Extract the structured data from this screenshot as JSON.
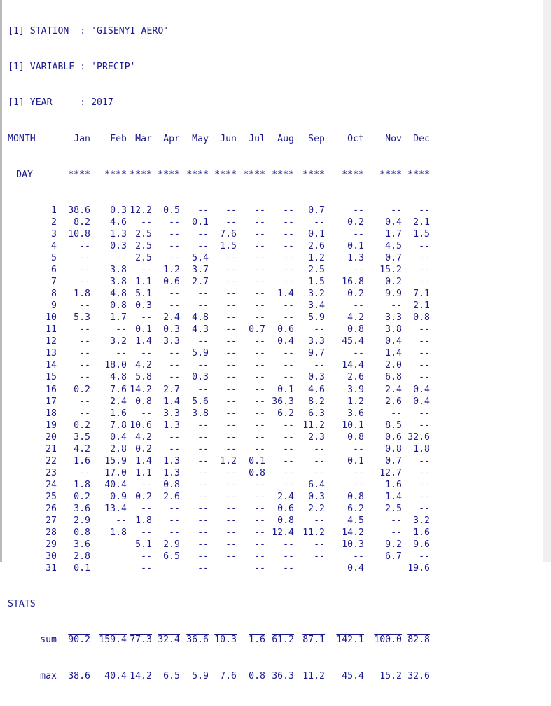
{
  "header": {
    "station_line": "[1] STATION  : 'GISENYI AERO'",
    "variable_line": "[1] VARIABLE : 'PRECIP'",
    "year_line": "[1] YEAR     : 2017"
  },
  "columns": {
    "month_label": "MONTH",
    "day_label": "DAY",
    "months": [
      "Jan",
      "Feb",
      "Mar",
      "Apr",
      "May",
      "Jun",
      "Jul",
      "Aug",
      "Sep",
      "Oct",
      "Nov",
      "Dec"
    ],
    "stars": "****"
  },
  "rows": [
    {
      "day": "1",
      "v": [
        "38.6",
        "0.3",
        "12.2",
        "0.5",
        "--",
        "--",
        "--",
        "--",
        "0.7",
        "--",
        "--",
        "--"
      ]
    },
    {
      "day": "2",
      "v": [
        "8.2",
        "4.6",
        "--",
        "--",
        "0.1",
        "--",
        "--",
        "--",
        "--",
        "0.2",
        "0.4",
        "2.1"
      ]
    },
    {
      "day": "3",
      "v": [
        "10.8",
        "1.3",
        "2.5",
        "--",
        "--",
        "7.6",
        "--",
        "--",
        "0.1",
        "--",
        "1.7",
        "1.5"
      ]
    },
    {
      "day": "4",
      "v": [
        "--",
        "0.3",
        "2.5",
        "--",
        "--",
        "1.5",
        "--",
        "--",
        "2.6",
        "0.1",
        "4.5",
        "--"
      ]
    },
    {
      "day": "5",
      "v": [
        "--",
        "--",
        "2.5",
        "--",
        "5.4",
        "--",
        "--",
        "--",
        "1.2",
        "1.3",
        "0.7",
        "--"
      ]
    },
    {
      "day": "6",
      "v": [
        "--",
        "3.8",
        "--",
        "1.2",
        "3.7",
        "--",
        "--",
        "--",
        "2.5",
        "--",
        "15.2",
        "--"
      ]
    },
    {
      "day": "7",
      "v": [
        "--",
        "3.8",
        "1.1",
        "0.6",
        "2.7",
        "--",
        "--",
        "--",
        "1.5",
        "16.8",
        "0.2",
        "--"
      ]
    },
    {
      "day": "8",
      "v": [
        "1.8",
        "4.8",
        "5.1",
        "--",
        "--",
        "--",
        "--",
        "1.4",
        "3.2",
        "0.2",
        "9.9",
        "7.1"
      ]
    },
    {
      "day": "9",
      "v": [
        "--",
        "0.8",
        "0.3",
        "--",
        "--",
        "--",
        "--",
        "--",
        "3.4",
        "--",
        "--",
        "2.1"
      ]
    },
    {
      "day": "10",
      "v": [
        "5.3",
        "1.7",
        "--",
        "2.4",
        "4.8",
        "--",
        "--",
        "--",
        "5.9",
        "4.2",
        "3.3",
        "0.8"
      ]
    },
    {
      "day": "11",
      "v": [
        "--",
        "--",
        "0.1",
        "0.3",
        "4.3",
        "--",
        "0.7",
        "0.6",
        "--",
        "0.8",
        "3.8",
        "--"
      ]
    },
    {
      "day": "12",
      "v": [
        "--",
        "3.2",
        "1.4",
        "3.3",
        "--",
        "--",
        "--",
        "0.4",
        "3.3",
        "45.4",
        "0.4",
        "--"
      ]
    },
    {
      "day": "13",
      "v": [
        "--",
        "--",
        "--",
        "--",
        "5.9",
        "--",
        "--",
        "--",
        "9.7",
        "--",
        "1.4",
        "--"
      ]
    },
    {
      "day": "14",
      "v": [
        "--",
        "18.0",
        "4.2",
        "--",
        "--",
        "--",
        "--",
        "--",
        "--",
        "14.4",
        "2.0",
        "--"
      ]
    },
    {
      "day": "15",
      "v": [
        "--",
        "4.8",
        "5.8",
        "--",
        "0.3",
        "--",
        "--",
        "--",
        "0.3",
        "2.6",
        "6.8",
        "--"
      ]
    },
    {
      "day": "16",
      "v": [
        "0.2",
        "7.6",
        "14.2",
        "2.7",
        "--",
        "--",
        "--",
        "0.1",
        "4.6",
        "3.9",
        "2.4",
        "0.4"
      ]
    },
    {
      "day": "17",
      "v": [
        "--",
        "2.4",
        "0.8",
        "1.4",
        "5.6",
        "--",
        "--",
        "36.3",
        "8.2",
        "1.2",
        "2.6",
        "0.4"
      ]
    },
    {
      "day": "18",
      "v": [
        "--",
        "1.6",
        "--",
        "3.3",
        "3.8",
        "--",
        "--",
        "6.2",
        "6.3",
        "3.6",
        "--",
        "--"
      ]
    },
    {
      "day": "19",
      "v": [
        "0.2",
        "7.8",
        "10.6",
        "1.3",
        "--",
        "--",
        "--",
        "--",
        "11.2",
        "10.1",
        "8.5",
        "--"
      ]
    },
    {
      "day": "20",
      "v": [
        "3.5",
        "0.4",
        "4.2",
        "--",
        "--",
        "--",
        "--",
        "--",
        "2.3",
        "0.8",
        "0.6",
        "32.6"
      ]
    },
    {
      "day": "21",
      "v": [
        "4.2",
        "2.8",
        "0.2",
        "--",
        "--",
        "--",
        "--",
        "--",
        "--",
        "--",
        "0.8",
        "1.8"
      ]
    },
    {
      "day": "22",
      "v": [
        "1.6",
        "15.9",
        "1.4",
        "1.3",
        "--",
        "1.2",
        "0.1",
        "--",
        "--",
        "0.1",
        "0.7",
        "--"
      ]
    },
    {
      "day": "23",
      "v": [
        "--",
        "17.0",
        "1.1",
        "1.3",
        "--",
        "--",
        "0.8",
        "--",
        "--",
        "--",
        "12.7",
        "--"
      ]
    },
    {
      "day": "24",
      "v": [
        "1.8",
        "40.4",
        "--",
        "0.8",
        "--",
        "--",
        "--",
        "--",
        "6.4",
        "--",
        "1.6",
        "--"
      ]
    },
    {
      "day": "25",
      "v": [
        "0.2",
        "0.9",
        "0.2",
        "2.6",
        "--",
        "--",
        "--",
        "2.4",
        "0.3",
        "0.8",
        "1.4",
        "--"
      ]
    },
    {
      "day": "26",
      "v": [
        "3.6",
        "13.4",
        "--",
        "--",
        "--",
        "--",
        "--",
        "0.6",
        "2.2",
        "6.2",
        "2.5",
        "--"
      ]
    },
    {
      "day": "27",
      "v": [
        "2.9",
        "--",
        "1.8",
        "--",
        "--",
        "--",
        "--",
        "0.8",
        "--",
        "4.5",
        "--",
        "3.2"
      ]
    },
    {
      "day": "28",
      "v": [
        "0.8",
        "1.8",
        "--",
        "--",
        "--",
        "--",
        "--",
        "12.4",
        "11.2",
        "14.2",
        "--",
        "1.6"
      ]
    },
    {
      "day": "29",
      "v": [
        "3.6",
        "",
        "5.1",
        "2.9",
        "--",
        "--",
        "--",
        "--",
        "--",
        "10.3",
        "9.2",
        "9.6"
      ]
    },
    {
      "day": "30",
      "v": [
        "2.8",
        "",
        "--",
        "6.5",
        "--",
        "--",
        "--",
        "--",
        "--",
        "--",
        "6.7",
        "--"
      ]
    },
    {
      "day": "31",
      "v": [
        "0.1",
        "",
        "--",
        "",
        "--",
        "",
        "--",
        "--",
        "",
        "0.4",
        "",
        "19.6"
      ]
    }
  ],
  "stats": {
    "label": "STATS",
    "sum_label": "sum",
    "sum": [
      "90.2",
      "159.4",
      "77.3",
      "32.4",
      "36.6",
      "10.3",
      "1.6",
      "61.2",
      "87.1",
      "142.1",
      "100.0",
      "82.8"
    ],
    "max_label": "max",
    "max": [
      "38.6",
      "40.4",
      "14.2",
      "6.5",
      "5.9",
      "7.6",
      "0.8",
      "36.3",
      "11.2",
      "45.4",
      "15.2",
      "32.6"
    ]
  }
}
